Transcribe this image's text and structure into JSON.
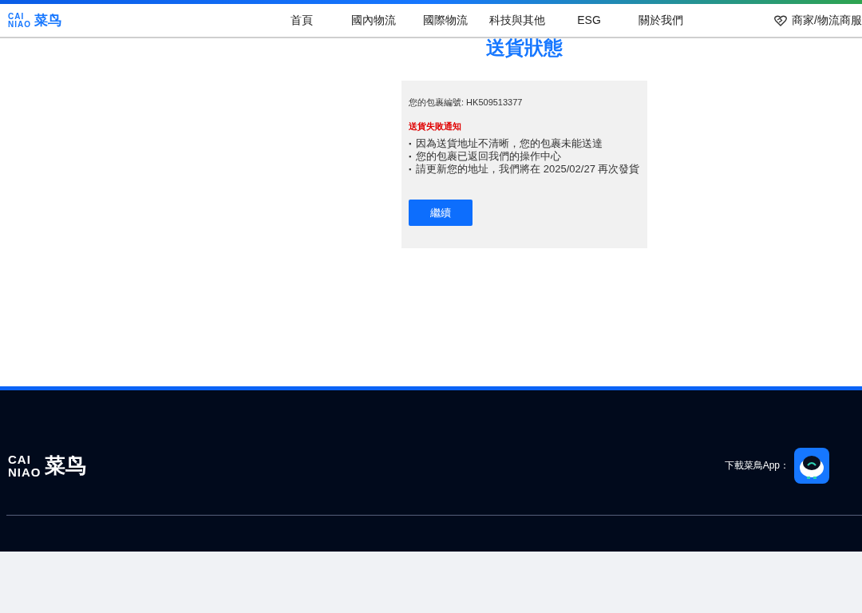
{
  "header": {
    "logo": {
      "line1": "CAI",
      "line2": "NIAO",
      "chinese": "菜鸟"
    },
    "nav": [
      {
        "label": "首頁"
      },
      {
        "label": "國內物流"
      },
      {
        "label": "國際物流"
      },
      {
        "label": "科技與其他"
      },
      {
        "label": "ESG"
      },
      {
        "label": "關於我們"
      }
    ],
    "merchant_link": "商家/物流商服"
  },
  "page_title": "送貨狀態",
  "card": {
    "tracking": "您的包裹編號: HK509513377",
    "alert": "送貨失敗通知",
    "bullet": "▪",
    "items": [
      "因為送貨地址不清晰，您的包裹未能送達",
      "您的包裹已返回我們的操作中心",
      "請更新您的地址，我們將在 2025/02/27 再次發貨"
    ],
    "button": "繼續"
  },
  "footer": {
    "logo": {
      "line1": "CAI",
      "line2": "NIAO",
      "chinese": "菜鸟"
    },
    "app_label": "下載菜鳥App："
  }
}
